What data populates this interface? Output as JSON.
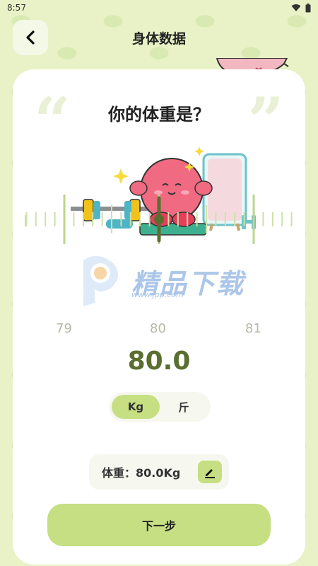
{
  "status": {
    "time": "8:57"
  },
  "header": {
    "title": "身体数据"
  },
  "main": {
    "question": "你的体重是？",
    "ruler": {
      "labels": [
        "79",
        "80",
        "81"
      ]
    },
    "value": "80.0",
    "units": [
      "Kg",
      "斤"
    ],
    "selected_unit": "Kg",
    "summary": "体重：80.0Kg",
    "next_label": "下一步"
  },
  "watermark": {
    "text": "精品下载",
    "url": "www.jpp.com"
  },
  "colors": {
    "accent": "#c5df82",
    "value_text": "#5a6e30",
    "background": "#e8f2c6"
  }
}
